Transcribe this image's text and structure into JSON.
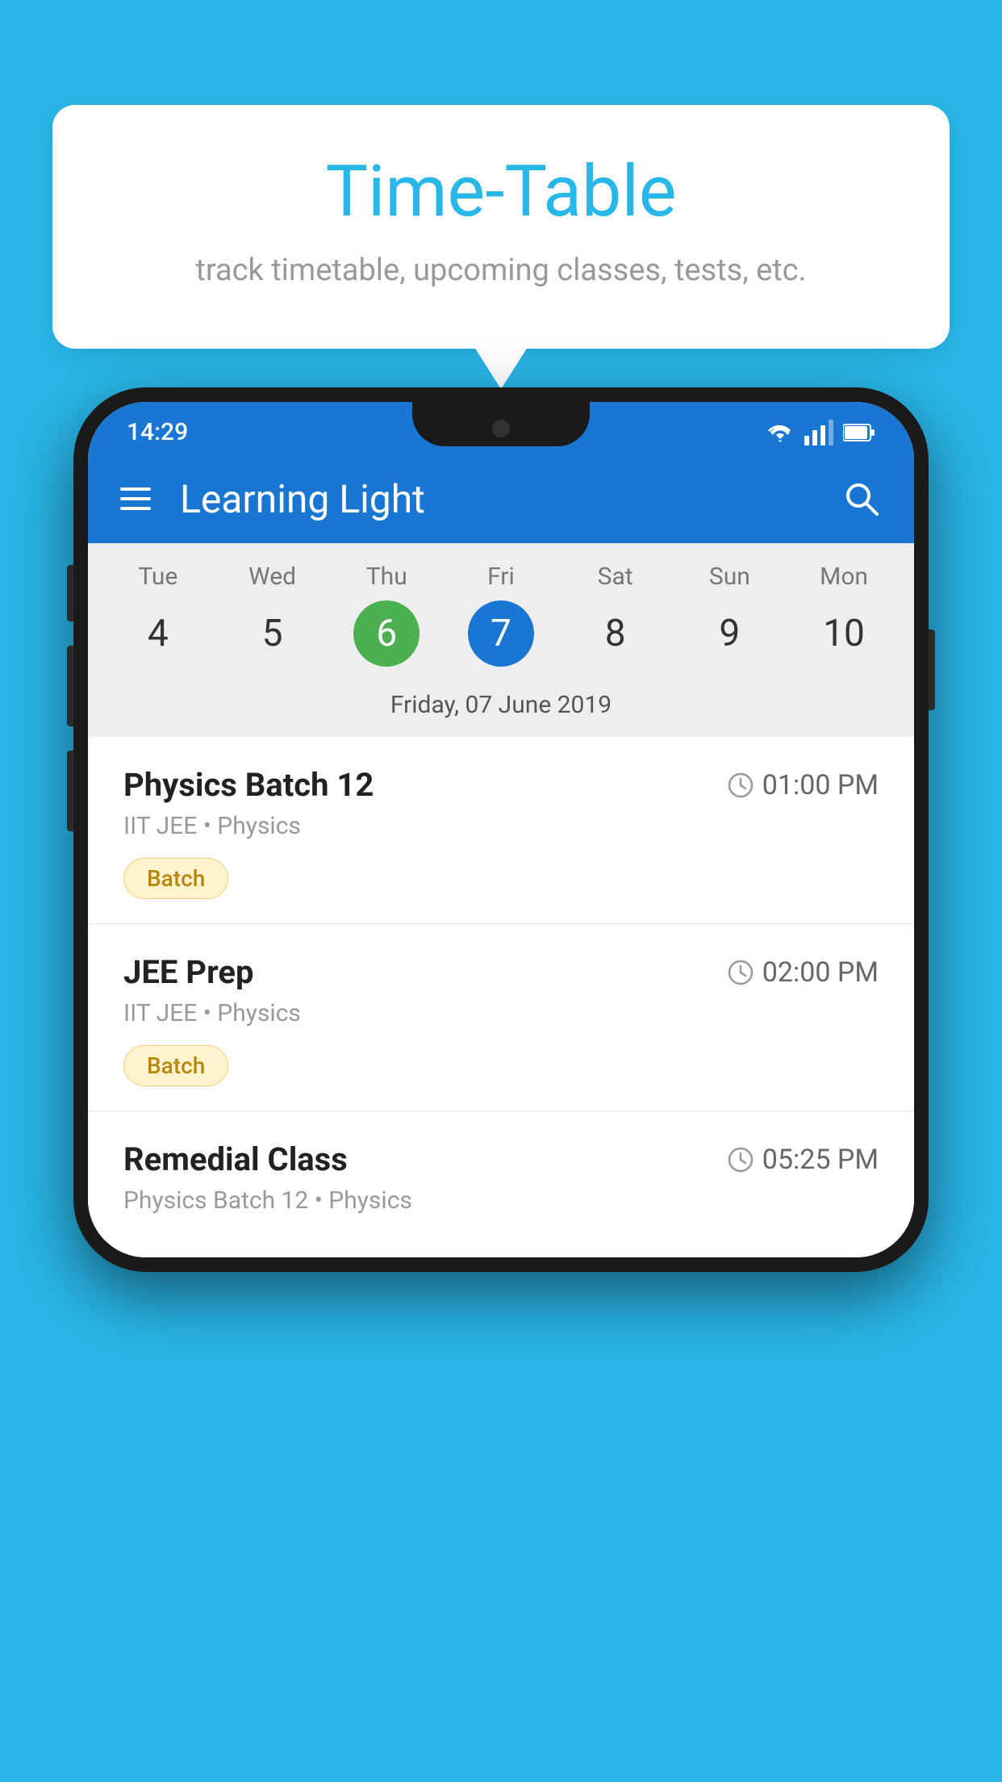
{
  "background_color": "#29b6e8",
  "speech_bubble": {
    "title": "Time-Table",
    "subtitle": "track timetable, upcoming classes, tests, etc."
  },
  "phone": {
    "status_bar": {
      "time": "14:29",
      "icons": [
        "wifi",
        "signal",
        "battery"
      ]
    },
    "app_bar": {
      "title": "Learning Light",
      "hamburger_label": "menu",
      "search_label": "search"
    },
    "calendar": {
      "days": [
        {
          "label": "Tue",
          "num": "4",
          "state": "normal"
        },
        {
          "label": "Wed",
          "num": "5",
          "state": "normal"
        },
        {
          "label": "Thu",
          "num": "6",
          "state": "today"
        },
        {
          "label": "Fri",
          "num": "7",
          "state": "selected"
        },
        {
          "label": "Sat",
          "num": "8",
          "state": "normal"
        },
        {
          "label": "Sun",
          "num": "9",
          "state": "normal"
        },
        {
          "label": "Mon",
          "num": "10",
          "state": "normal"
        }
      ],
      "selected_date_label": "Friday, 07 June 2019"
    },
    "schedule": [
      {
        "title": "Physics Batch 12",
        "time": "01:00 PM",
        "subtitle": "IIT JEE • Physics",
        "badge": "Batch"
      },
      {
        "title": "JEE Prep",
        "time": "02:00 PM",
        "subtitle": "IIT JEE • Physics",
        "badge": "Batch"
      },
      {
        "title": "Remedial Class",
        "time": "05:25 PM",
        "subtitle": "Physics Batch 12 • Physics",
        "badge": null
      }
    ]
  }
}
